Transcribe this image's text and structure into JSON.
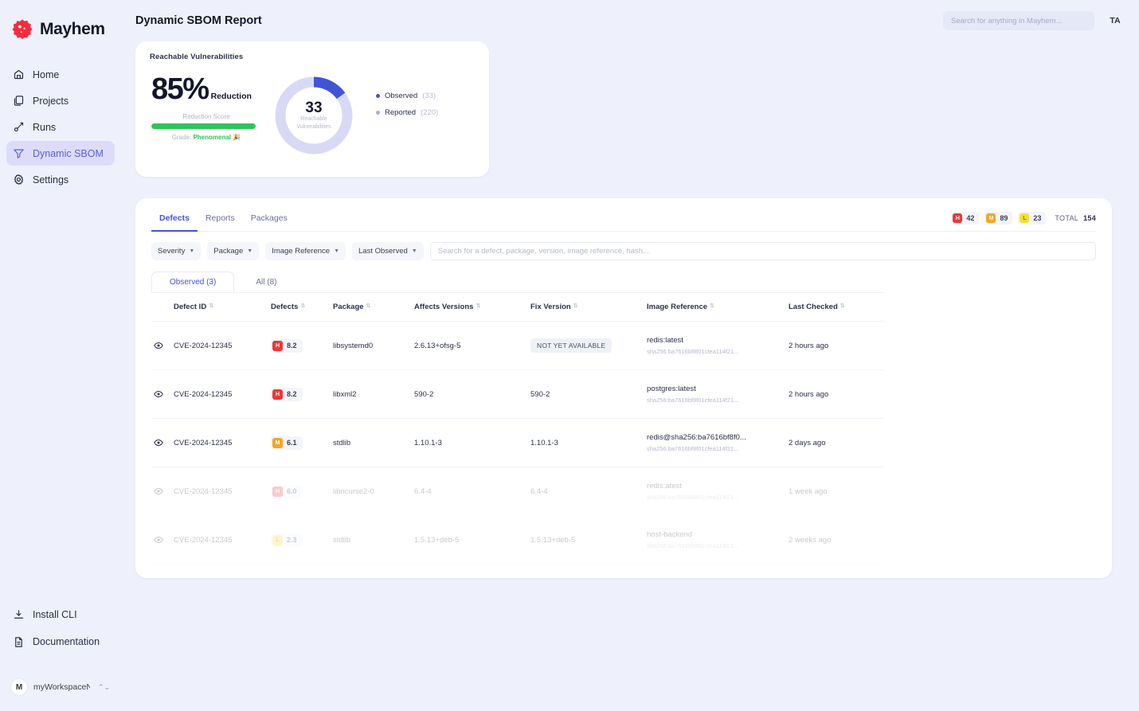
{
  "brand": {
    "name": "Mayhem",
    "logo_icon": "mayhem-logo-icon"
  },
  "sidebar": {
    "items": [
      {
        "label": "Home",
        "icon": "home-icon",
        "active": false
      },
      {
        "label": "Projects",
        "icon": "projects-icon",
        "active": false
      },
      {
        "label": "Runs",
        "icon": "runs-icon",
        "active": false
      },
      {
        "label": "Dynamic SBOM",
        "icon": "filter-funnel-icon",
        "active": true
      },
      {
        "label": "Settings",
        "icon": "gear-icon",
        "active": false
      }
    ],
    "bottom_links": [
      {
        "label": "Install CLI",
        "icon": "download-icon"
      },
      {
        "label": "Documentation",
        "icon": "document-icon"
      }
    ],
    "workspace": {
      "initial": "M",
      "name": "myWorkspaceName...",
      "chevron_icon": "chevron-updown-icon"
    }
  },
  "header": {
    "title": "Dynamic SBOM Report",
    "search_placeholder": "Search for anything in Mayhem...",
    "search_value": "",
    "avatar_initials": "TA"
  },
  "summary": {
    "title": "Reachable Vulnerabilities",
    "percent": "85%",
    "percent_label": "Reduction",
    "bar_caption": "Reduction Score",
    "bar_fill_percent": 100,
    "bar_color": "#2ec55a",
    "grade_prefix": "Grade:",
    "grade_value": "Phenomenal",
    "grade_emoji": "🎉",
    "donut_number": "33",
    "donut_sub_line1": "Reachable",
    "donut_sub_line2": "Vulnerabilities",
    "legend": [
      {
        "label": "Observed",
        "value": "(33)",
        "color": "#4054d6"
      },
      {
        "label": "Reported",
        "value": "(220)",
        "color": "#a3abee"
      }
    ]
  },
  "chart_data": {
    "type": "pie",
    "title": "Reachable Vulnerabilities",
    "labels": [
      "Observed",
      "Reported"
    ],
    "values": [
      33,
      220
    ],
    "colors": [
      "#4054d6",
      "#d8daf5"
    ],
    "center_value": 33,
    "center_label": "Reachable Vulnerabilities",
    "legend_position": "right",
    "donut": true
  },
  "panel": {
    "tabs": [
      {
        "label": "Defects",
        "active": true
      },
      {
        "label": "Reports",
        "active": false
      },
      {
        "label": "Packages",
        "active": false
      }
    ],
    "badges": [
      {
        "letter": "H",
        "count": "42",
        "color": "#ef3636"
      },
      {
        "letter": "M",
        "count": "89",
        "color": "#f5a623"
      },
      {
        "letter": "L",
        "count": "23",
        "color": "#f5e034"
      }
    ],
    "total_label": "TOTAL",
    "total_value": "154",
    "filters": [
      {
        "label": "Severity"
      },
      {
        "label": "Package"
      },
      {
        "label": "Image Reference"
      },
      {
        "label": "Last Observed"
      }
    ],
    "search_placeholder": "Search for a defect, package, version, image reference, hash...",
    "search_value": "",
    "subtabs": [
      {
        "label": "Observed (3)",
        "active": true
      },
      {
        "label": "All (8)",
        "active": false
      }
    ],
    "columns": [
      "Defect ID",
      "Defects",
      "Package",
      "Affects Versions",
      "Fix Version",
      "Image Reference",
      "Last Checked"
    ],
    "rows": [
      {
        "defect_id": "CVE-2024-12345",
        "severity_letter": "H",
        "severity_score": "8.2",
        "severity_color": "#ef3636",
        "package": "libsystemd0",
        "affects_versions": "2.6.13+ofsg-5",
        "fix_version": "NOT YET AVAILABLE",
        "fix_not_available": true,
        "image_name": "redis:latest",
        "image_hash": "sha256:ba7616bf8f01cfea114f21...",
        "last_checked": "2 hours ago",
        "faded": false
      },
      {
        "defect_id": "CVE-2024-12345",
        "severity_letter": "H",
        "severity_score": "8.2",
        "severity_color": "#ef3636",
        "package": "libxml2",
        "affects_versions": "590-2",
        "fix_version": "590-2",
        "fix_not_available": false,
        "image_name": "postgres:latest",
        "image_hash": "sha256:ba7616bf8f01cfea114f21...",
        "last_checked": "2 hours ago",
        "faded": false
      },
      {
        "defect_id": "CVE-2024-12345",
        "severity_letter": "M",
        "severity_score": "6.1",
        "severity_color": "#f5a623",
        "package": "stdlib",
        "affects_versions": "1.10.1-3",
        "fix_version": "1.10.1-3",
        "fix_not_available": false,
        "image_name": "redis@sha256:ba7616bf8f0...",
        "image_hash": "sha256:ba7616bf8f01cfea114f21...",
        "last_checked": "2 days ago",
        "faded": false
      },
      {
        "defect_id": "CVE-2024-12345",
        "severity_letter": "H",
        "severity_score": "6.0",
        "severity_color": "#ef3636",
        "package": "libncurse2-0",
        "affects_versions": "6.4-4",
        "fix_version": "6.4-4",
        "fix_not_available": false,
        "image_name": "redis:atest",
        "image_hash": "sha256:ba7616bf8f01cfea114f21...",
        "last_checked": "1 week ago",
        "faded": true
      },
      {
        "defect_id": "CVE-2024-12345",
        "severity_letter": "L",
        "severity_score": "2.3",
        "severity_color": "#f5e034",
        "package": "stdlib",
        "affects_versions": "1.5.13+deb-5",
        "fix_version": "1.5.13+deb-5",
        "fix_not_available": false,
        "image_name": "host-backend",
        "image_hash": "sha256:ba7616bf8f01cfea114f21...",
        "last_checked": "2 weeks ago",
        "faded": true
      }
    ]
  }
}
